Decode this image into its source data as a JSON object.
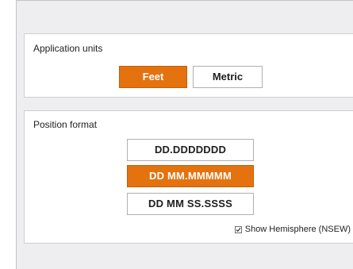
{
  "units": {
    "title": "Application units",
    "options": [
      {
        "label": "Feet",
        "selected": true
      },
      {
        "label": "Metric",
        "selected": false
      }
    ]
  },
  "position": {
    "title": "Position format",
    "options": [
      {
        "label": "DD.DDDDDDD",
        "selected": false
      },
      {
        "label": "DD MM.MMMMM",
        "selected": true
      },
      {
        "label": "DD MM SS.SSSS",
        "selected": false
      }
    ],
    "hemisphere": {
      "label": "Show Hemisphere (NSEW)",
      "checked": true
    }
  },
  "colors": {
    "accent": "#e3720f",
    "panel_background": "#eeeef0"
  }
}
